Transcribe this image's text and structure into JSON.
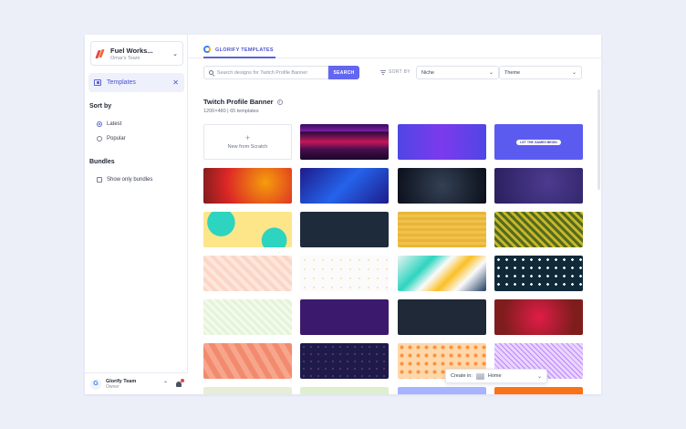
{
  "sidebar": {
    "workspace": {
      "name": "Fuel Works...",
      "subtitle": "Omar's Team"
    },
    "templates_label": "Templates",
    "sort_title": "Sort by",
    "sort_options": [
      "Latest",
      "Popular"
    ],
    "sort_selected": "Latest",
    "bundles_title": "Bundles",
    "bundles_option": "Show only bundles",
    "team": {
      "logo": "G",
      "name": "Glorify Team",
      "role": "Owner"
    }
  },
  "main": {
    "tab_label": "GLORIFY TEMPLATES",
    "search": {
      "placeholder": "Search designs for Twitch Profile Banner",
      "button": "SEARCH"
    },
    "sort_by_label": "SORT BY",
    "niche_select": "Niche",
    "theme_select": "Theme",
    "title": "Twitch Profile Banner",
    "subtitle": "1200×480 | 65 templates",
    "new_card": {
      "plus": "+",
      "label": "New from Scratch"
    },
    "banner_text": "LET THE GAMES BEGIN",
    "create_in_label": "Create in:",
    "create_in_value": "Home"
  },
  "colors": {
    "accent": "#6366f1",
    "accent_text": "#4a53cf",
    "sidebar_active_bg": "#eef0fc",
    "page_bg": "#eceef8"
  },
  "icons": [
    "chevron-down-icon",
    "folder-icon",
    "close-icon",
    "search-icon",
    "sort-icon",
    "info-icon",
    "bell-icon",
    "chat-icon",
    "plus-icon",
    "home-icon"
  ]
}
